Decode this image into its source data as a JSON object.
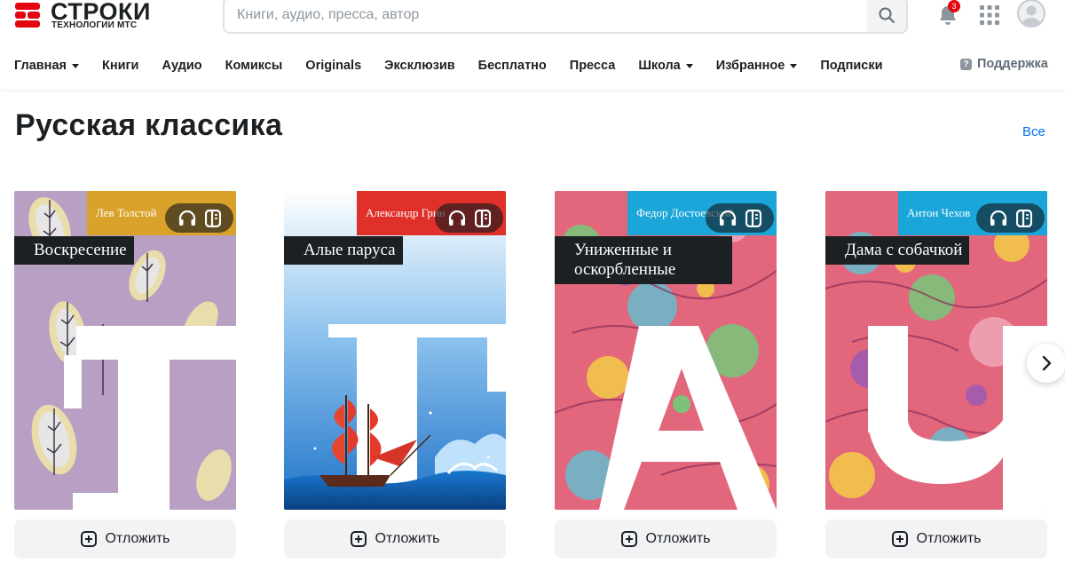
{
  "brand": {
    "title": "СТРОКИ",
    "subtitle": "ТЕХНОЛОГИИ МТС",
    "color": "#e30611"
  },
  "search": {
    "placeholder": "Книги, аудио, пресса, автор",
    "value": ""
  },
  "header": {
    "notifications_count": "3"
  },
  "nav": {
    "items": [
      {
        "label": "Главная",
        "dropdown": true
      },
      {
        "label": "Книги",
        "dropdown": false
      },
      {
        "label": "Аудио",
        "dropdown": false
      },
      {
        "label": "Комиксы",
        "dropdown": false
      },
      {
        "label": "Originals",
        "dropdown": false
      },
      {
        "label": "Эксклюзив",
        "dropdown": false
      },
      {
        "label": "Бесплатно",
        "dropdown": false
      },
      {
        "label": "Пресса",
        "dropdown": false
      },
      {
        "label": "Школа",
        "dropdown": true
      },
      {
        "label": "Избранное",
        "dropdown": true
      },
      {
        "label": "Подписки",
        "dropdown": false
      }
    ],
    "support_label": "Поддержка"
  },
  "section": {
    "title": "Русская классика",
    "see_all": "Все"
  },
  "books": [
    {
      "author": "Лев Толстой",
      "title": "Воскресение",
      "accent": "#d9a22b",
      "bg": "#b8a0c4",
      "letter": "Т",
      "button": "Отложить"
    },
    {
      "author": "Александр Грин",
      "title": "Алые паруса",
      "accent": "#e0302a",
      "bg": "#3f8fd6",
      "letter": "Г",
      "button": "Отложить"
    },
    {
      "author": "Федор Достоевский",
      "title": "Униженные и оскорбленные",
      "accent": "#1aa6d9",
      "bg": "#e2677c",
      "letter": "Д",
      "button": "Отложить"
    },
    {
      "author": "Антон Чехов",
      "title": "Дама с собачкой",
      "accent": "#1aa6d9",
      "bg": "#e2677c",
      "letter": "Ч",
      "button": "Отложить"
    }
  ],
  "icons": {
    "headphones": "headphones-icon",
    "book": "book-icon",
    "plus": "plus-square-icon",
    "next": "chevron-right-icon"
  }
}
